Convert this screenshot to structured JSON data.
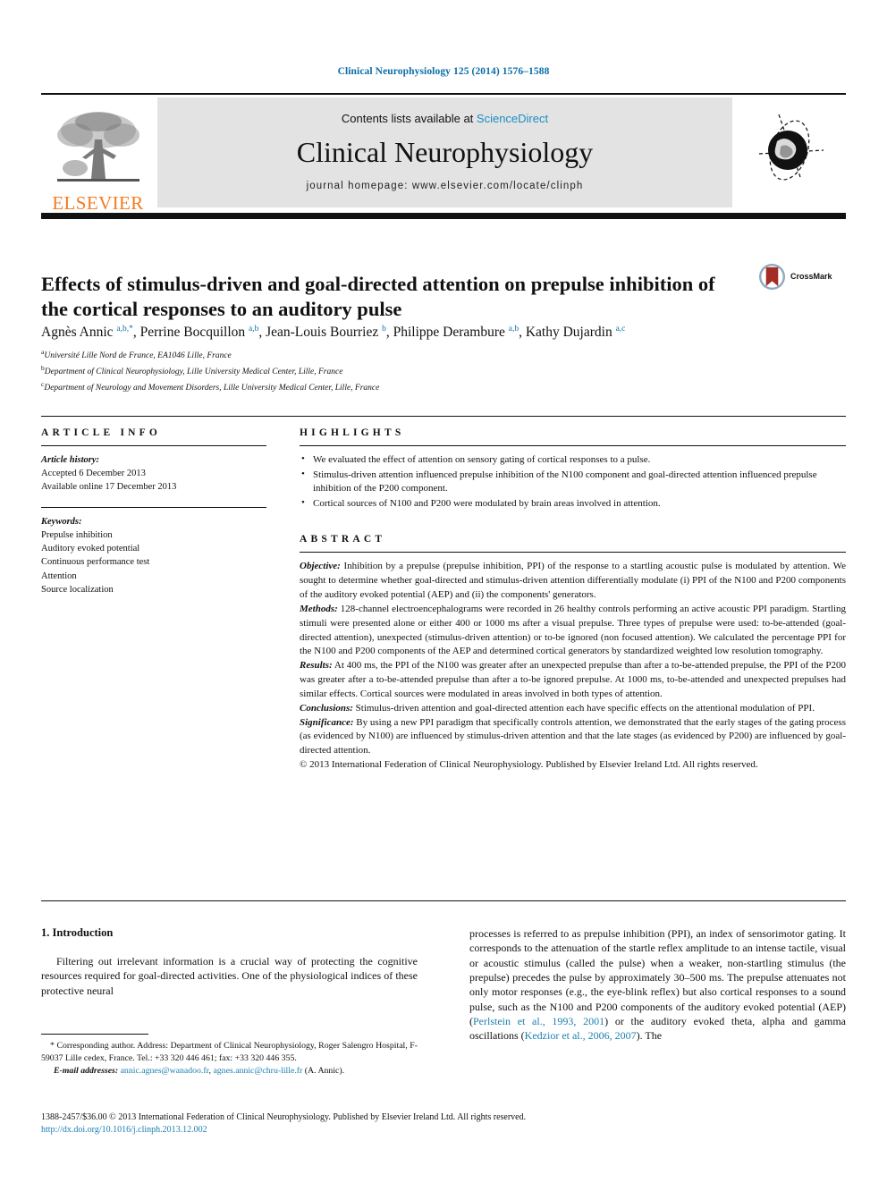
{
  "running_head": "Clinical Neurophysiology 125 (2014) 1576–1588",
  "masthead": {
    "contents_prefix": "Contents lists available at ",
    "sciencedirect": "ScienceDirect",
    "journal_title": "Clinical Neurophysiology",
    "homepage": "journal homepage: www.elsevier.com/locate/clinph",
    "publisher_word": "ELSEVIER",
    "publisher_color": "#F47B20",
    "link_color": "#1a8ec4"
  },
  "article": {
    "title": "Effects of stimulus-driven and goal-directed attention on prepulse inhibition of the cortical responses to an auditory pulse",
    "crossmark_label": "CrossMark",
    "authors_html": "Agnès Annic <sup>a,b,</sup><sup>*</sup>, Perrine Bocquillon <sup>a,b</sup>, Jean-Louis Bourriez <sup>b</sup>, Philippe Derambure <sup>a,b</sup>, Kathy Dujardin <sup>a,c</sup>",
    "affiliations": [
      {
        "mark": "a",
        "text": "Université Lille Nord de France, EA1046 Lille, France"
      },
      {
        "mark": "b",
        "text": "Department of Clinical Neurophysiology, Lille University Medical Center, Lille, France"
      },
      {
        "mark": "c",
        "text": "Department of Neurology and Movement Disorders, Lille University Medical Center, Lille, France"
      }
    ]
  },
  "article_info": {
    "heading": "ARTICLE INFO",
    "history_label": "Article history:",
    "history": [
      "Accepted 6 December 2013",
      "Available online 17 December 2013"
    ],
    "keywords_label": "Keywords:",
    "keywords": [
      "Prepulse inhibition",
      "Auditory evoked potential",
      "Continuous performance test",
      "Attention",
      "Source localization"
    ]
  },
  "highlights": {
    "heading": "HIGHLIGHTS",
    "items": [
      "We evaluated the effect of attention on sensory gating of cortical responses to a pulse.",
      "Stimulus-driven attention influenced prepulse inhibition of the N100 component and goal-directed attention influenced prepulse inhibition of the P200 component.",
      "Cortical sources of N100 and P200 were modulated by brain areas involved in attention."
    ]
  },
  "abstract": {
    "heading": "ABSTRACT",
    "sections": [
      {
        "label": "Objective:",
        "text": " Inhibition by a prepulse (prepulse inhibition, PPI) of the response to a startling acoustic pulse is modulated by attention. We sought to determine whether goal-directed and stimulus-driven attention differentially modulate (i) PPI of the N100 and P200 components of the auditory evoked potential (AEP) and (ii) the components' generators."
      },
      {
        "label": "Methods:",
        "text": " 128-channel electroencephalograms were recorded in 26 healthy controls performing an active acoustic PPI paradigm. Startling stimuli were presented alone or either 400 or 1000 ms after a visual prepulse. Three types of prepulse were used: to-be-attended (goal-directed attention), unexpected (stimulus-driven attention) or to-be ignored (non focused attention). We calculated the percentage PPI for the N100 and P200 components of the AEP and determined cortical generators by standardized weighted low resolution tomography."
      },
      {
        "label": "Results:",
        "text": " At 400 ms, the PPI of the N100 was greater after an unexpected prepulse than after a to-be-attended prepulse, the PPI of the P200 was greater after a to-be-attended prepulse than after a to-be ignored prepulse. At 1000 ms, to-be-attended and unexpected prepulses had similar effects. Cortical sources were modulated in areas involved in both types of attention."
      },
      {
        "label": "Conclusions:",
        "text": " Stimulus-driven attention and goal-directed attention each have specific effects on the attentional modulation of PPI."
      },
      {
        "label": "Significance:",
        "text": " By using a new PPI paradigm that specifically controls attention, we demonstrated that the early stages of the gating process (as evidenced by N100) are influenced by stimulus-driven attention and that the late stages (as evidenced by P200) are influenced by goal-directed attention."
      }
    ],
    "copyright": "© 2013 International Federation of Clinical Neurophysiology. Published by Elsevier Ireland Ltd. All rights reserved."
  },
  "introduction": {
    "heading": "1. Introduction",
    "paragraph_left": "Filtering out irrelevant information is a crucial way of protecting the cognitive resources required for goal-directed activities. One of the physiological indices of these protective neural",
    "paragraph_right_a": "processes is referred to as prepulse inhibition (PPI), an index of sensorimotor gating. It corresponds to the attenuation of the startle reflex amplitude to an intense tactile, visual or acoustic stimulus (called the pulse) when a weaker, non-startling stimulus (the prepulse) precedes the pulse by approximately 30–500 ms. The prepulse attenuates not only motor responses (e.g., the eye-blink reflex) but also cortical responses to a sound pulse, such as the N100 and P200 components of the auditory evoked potential (AEP) (",
    "citation_1": "Perlstein et al., 1993, 2001",
    "paragraph_right_b": ") or the auditory evoked theta, alpha and gamma oscillations (",
    "citation_2": "Kedzior et al., 2006, 2007",
    "paragraph_right_c": "). The"
  },
  "footnote": {
    "corresponding": "* Corresponding author. Address: Department of Clinical Neurophysiology, Roger Salengro Hospital, F-59037 Lille cedex, France. Tel.: +33 320 446 461; fax: +33 320 446 355.",
    "email_label": "E-mail addresses:",
    "email_1": "annic.agnes@wanadoo.fr",
    "email_2": "agnes.annic@chru-lille.fr",
    "email_suffix": " (A. Annic)."
  },
  "footer": {
    "issn_line": "1388-2457/$36.00 © 2013 International Federation of Clinical Neurophysiology. Published by Elsevier Ireland Ltd. All rights reserved.",
    "doi": "http://dx.doi.org/10.1016/j.clinph.2013.12.002"
  }
}
